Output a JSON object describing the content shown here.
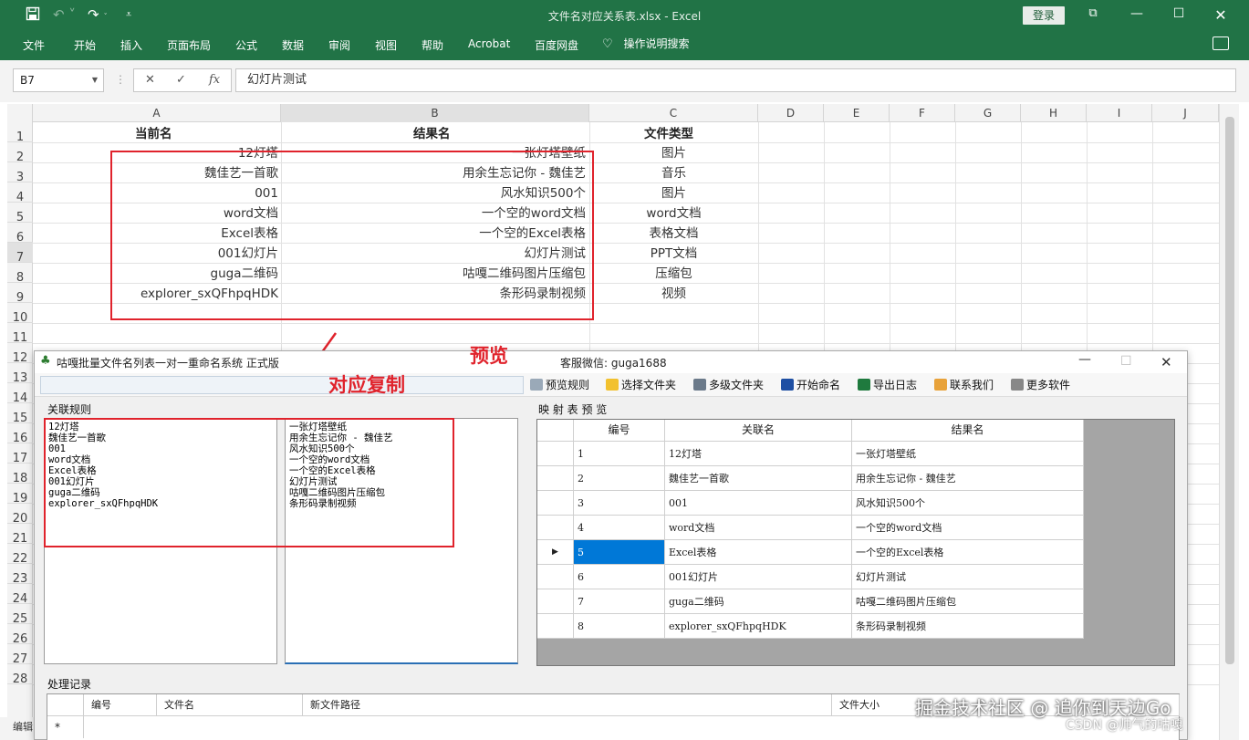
{
  "excel": {
    "title": "文件名对应关系表.xlsx  -  Excel",
    "login_label": "登录",
    "ribbon_tabs": [
      "文件",
      "开始",
      "插入",
      "页面布局",
      "公式",
      "数据",
      "审阅",
      "视图",
      "帮助",
      "Acrobat",
      "百度网盘"
    ],
    "tell_me": "操作说明搜索",
    "name_box": "B7",
    "formula_value": "幻灯片测试",
    "column_headers": [
      "A",
      "B",
      "C",
      "D",
      "E",
      "F",
      "G",
      "H",
      "I",
      "J"
    ],
    "row_numbers": [
      "1",
      "2",
      "3",
      "4",
      "5",
      "6",
      "7",
      "8",
      "9",
      "10",
      "11",
      "12",
      "13",
      "14",
      "15",
      "16",
      "17",
      "18",
      "19",
      "20",
      "21",
      "22",
      "23",
      "24",
      "25",
      "26",
      "27",
      "28"
    ],
    "table_headers": {
      "a": "当前名",
      "b": "结果名",
      "c": "文件类型"
    },
    "rows": [
      {
        "a": "12灯塔",
        "b": "一张灯塔壁纸",
        "c": "图片"
      },
      {
        "a": "魏佳艺一首歌",
        "b": "用余生忘记你 - 魏佳艺",
        "c": "音乐"
      },
      {
        "a": "001",
        "b": "风水知识500个",
        "c": "图片"
      },
      {
        "a": "word文档",
        "b": "一个空的word文档",
        "c": "word文档"
      },
      {
        "a": "Excel表格",
        "b": "一个空的Excel表格",
        "c": "表格文档"
      },
      {
        "a": "001幻灯片",
        "b": "幻灯片测试",
        "c": "PPT文档"
      },
      {
        "a": "guga二维码",
        "b": "咕嘎二维码图片压缩包",
        "c": "压缩包"
      },
      {
        "a": "explorer_sxQFhpqHDK",
        "b": "条形码录制视频",
        "c": "视频"
      }
    ],
    "status_left": "编辑"
  },
  "annotations": {
    "preview": "预览",
    "copy": "对应复制"
  },
  "dialog": {
    "title": "咕嘎批量文件名列表一对一重命名系统  正式版",
    "service": "客服微信: guga1688",
    "toolbar": [
      {
        "label": "预览规则",
        "icon": "preview-icon",
        "color": "#9aa9b8"
      },
      {
        "label": "选择文件夹",
        "icon": "folder-icon",
        "color": "#f2c12e"
      },
      {
        "label": "多级文件夹",
        "icon": "multi-folder-icon",
        "color": "#6b7a8a"
      },
      {
        "label": "开始命名",
        "icon": "start-icon",
        "color": "#1e4fa3"
      },
      {
        "label": "导出日志",
        "icon": "excel-export-icon",
        "color": "#1f7a3e"
      },
      {
        "label": "联系我们",
        "icon": "contact-icon",
        "color": "#e8a23a"
      },
      {
        "label": "更多软件",
        "icon": "grid-icon",
        "color": "#888888"
      }
    ],
    "rules_group": "关联规则",
    "left_list": "12灯塔\n魏佳艺一首歌\n001\nword文档\nExcel表格\n001幻灯片\nguga二维码\nexplorer_sxQFhpqHDK",
    "right_list": "一张灯塔壁纸\n用余生忘记你 - 魏佳艺\n风水知识500个\n一个空的word文档\n一个空的Excel表格\n幻灯片测试\n咕嘎二维码图片压缩包\n条形码录制视频",
    "map_group": "映 射 表 预 览",
    "map_headers": [
      "编号",
      "关联名",
      "结果名"
    ],
    "map_rows": [
      {
        "no": "1",
        "assoc": "12灯塔",
        "result": "一张灯塔壁纸"
      },
      {
        "no": "2",
        "assoc": "魏佳艺一首歌",
        "result": "用余生忘记你 - 魏佳艺"
      },
      {
        "no": "3",
        "assoc": "001",
        "result": "风水知识500个"
      },
      {
        "no": "4",
        "assoc": "word文档",
        "result": "一个空的word文档"
      },
      {
        "no": "5",
        "assoc": "Excel表格",
        "result": "一个空的Excel表格"
      },
      {
        "no": "6",
        "assoc": "001幻灯片",
        "result": "幻灯片测试"
      },
      {
        "no": "7",
        "assoc": "guga二维码",
        "result": "咕嘎二维码图片压缩包"
      },
      {
        "no": "8",
        "assoc": "explorer_sxQFhpqHDK",
        "result": "条形码录制视频"
      }
    ],
    "selected_row": 4,
    "log_group": "处理记录",
    "log_headers": [
      "编号",
      "文件名",
      "新文件路径",
      "文件大小"
    ],
    "log_new_row": "*"
  },
  "watermark": {
    "main": "掘金技术社区 @ 追你到天边Go",
    "sub": "CSDN @帅气的咕嘎"
  }
}
